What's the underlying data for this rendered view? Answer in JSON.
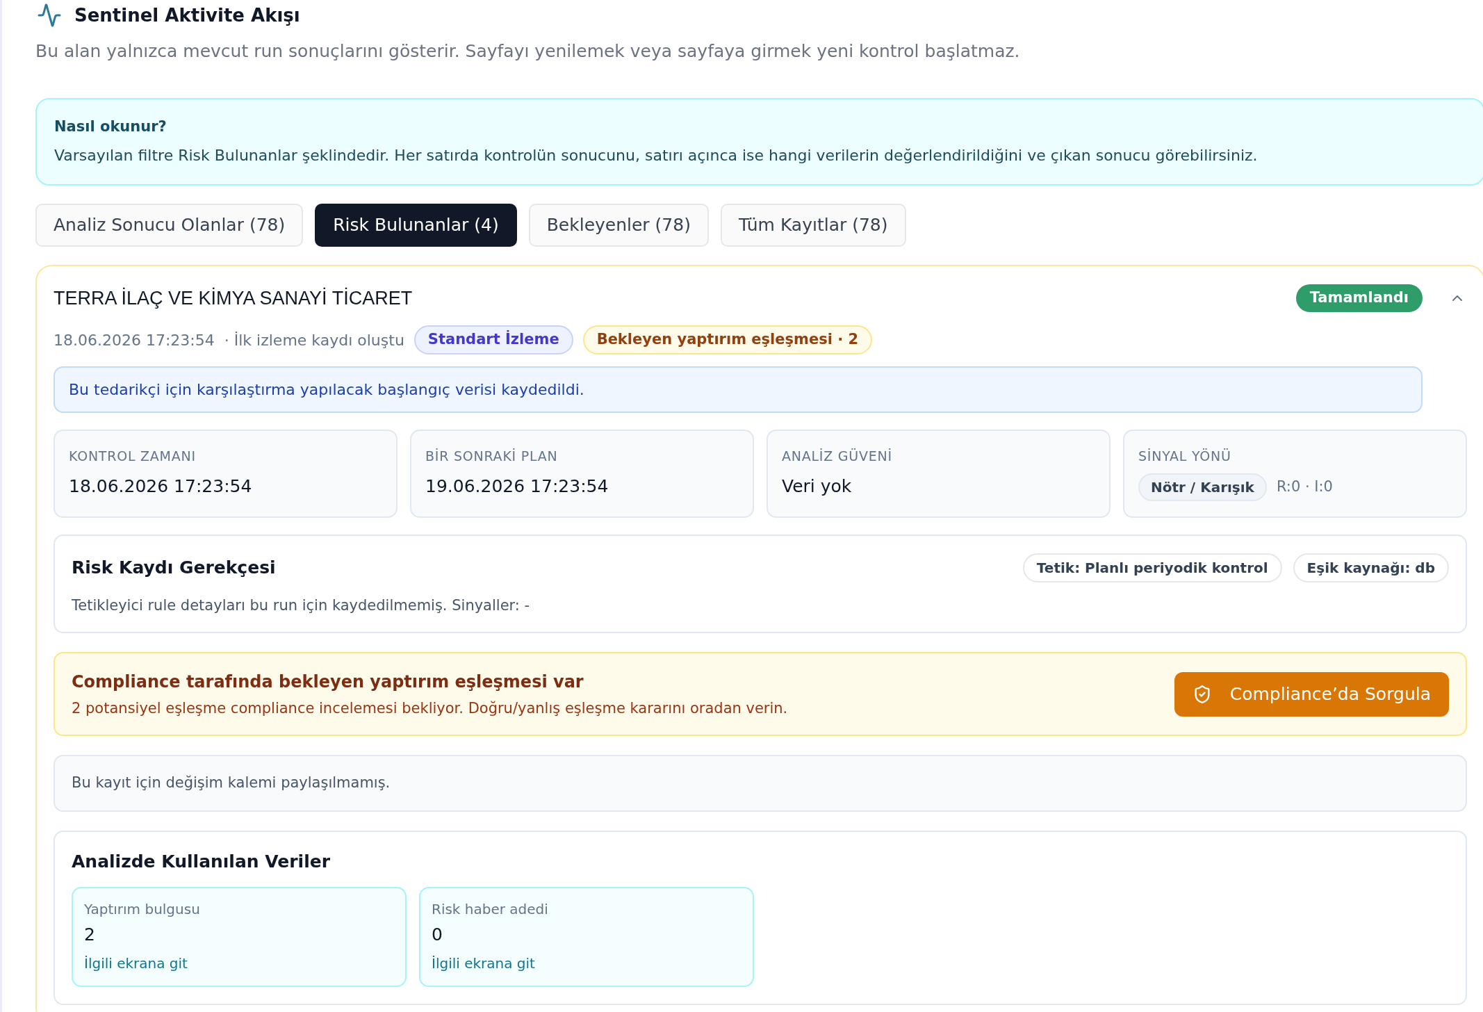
{
  "header": {
    "title": "Sentinel Aktivite Akışı",
    "subtitle": "Bu alan yalnızca mevcut run sonuçlarını gösterir. Sayfayı yenilemek veya sayfaya girmek yeni kontrol başlatmaz."
  },
  "info_box": {
    "title": "Nasıl okunur?",
    "text": "Varsayılan filtre Risk Bulunanlar şeklindedir. Her satırda kontrolün sonucunu, satırı açınca ise hangi verilerin değerlendirildiğini ve çıkan sonucu görebilirsiniz."
  },
  "tabs": [
    {
      "label": "Analiz Sonucu Olanlar (78)",
      "selected": false
    },
    {
      "label": "Risk Bulunanlar (4)",
      "selected": true
    },
    {
      "label": "Bekleyenler (78)",
      "selected": false
    },
    {
      "label": "Tüm Kayıtlar (78)",
      "selected": false
    }
  ],
  "record": {
    "company": "TERRA İLAÇ VE KİMYA SANAYİ TİCARET",
    "status": {
      "label": "Tamamlandı",
      "kind": "success"
    },
    "expanded": true,
    "timestamp": "18.06.2026 17:23:54",
    "event": "· İlk izleme kaydı oluştu",
    "tags": [
      {
        "label": "Standart İzleme",
        "kind": "info"
      },
      {
        "label": "Bekleyen yaptırım eşleşmesi · 2",
        "kind": "warning"
      }
    ],
    "note": "Bu tedarikçi için karşılaştırma yapılacak başlangıç verisi kaydedildi.",
    "stats": [
      {
        "kind": "text",
        "label": "KONTROL ZAMANI",
        "value": "18.06.2026 17:23:54"
      },
      {
        "kind": "text",
        "label": "BİR SONRAKİ PLAN",
        "value": "19.06.2026 17:23:54"
      },
      {
        "kind": "text",
        "label": "ANALİZ GÜVENİ",
        "value": "Veri yok"
      },
      {
        "kind": "signal",
        "label": "SİNYAL YÖNÜ",
        "pill": "Nötr / Karışık",
        "value": "R:0 · I:0"
      }
    ],
    "risk_reason": {
      "title": "Risk Kaydı Gerekçesi",
      "pills": [
        "Tetik: Planlı periyodik kontrol",
        "Eşik kaynağı: db"
      ],
      "text": "Tetikleyici rule detayları bu run için kaydedilmemiş. Sinyaller: -"
    },
    "compliance_alert": {
      "title": "Compliance tarafında bekleyen yaptırım eşleşmesi var",
      "text": "2 potansiyel eşleşme compliance incelemesi bekliyor. Doğru/yanlış eşleşme kararını oradan verin.",
      "button": "Compliance’da Sorgula"
    },
    "changes_note": "Bu kayıt için değişim kalemi paylaşılmamış.",
    "data_used": {
      "title": "Analizde Kullanılan Veriler",
      "items": [
        {
          "label": "Yaptırım bulgusu",
          "value": "2",
          "link": "İlgili ekrana git"
        },
        {
          "label": "Risk haber adedi",
          "value": "0",
          "link": "İlgili ekrana git"
        }
      ]
    }
  }
}
